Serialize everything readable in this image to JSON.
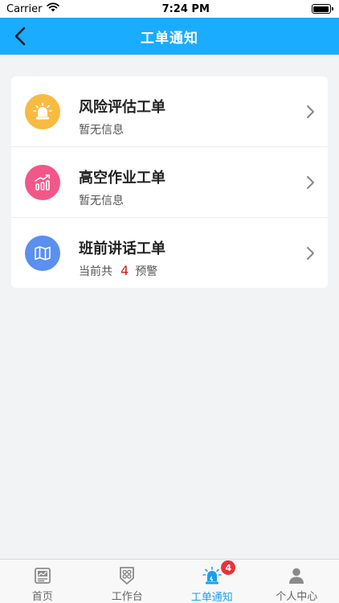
{
  "status_bar": {
    "carrier": "Carrier",
    "time": "7:24 PM"
  },
  "nav": {
    "title": "工单通知"
  },
  "work_orders": [
    {
      "title": "风险评估工单",
      "subtitle": "暂无信息",
      "icon": "alarm-light-icon",
      "color": "#f7bb42"
    },
    {
      "title": "高空作业工单",
      "subtitle": "暂无信息",
      "icon": "trend-chart-icon",
      "color": "#f2578a"
    },
    {
      "title": "班前讲话工单",
      "subtitle_prefix": "当前共",
      "count": "4",
      "subtitle_suffix": "预警",
      "icon": "map-icon",
      "color": "#5b8ff0"
    }
  ],
  "tabs": [
    {
      "label": "首页",
      "icon": "home-icon"
    },
    {
      "label": "工作台",
      "icon": "workbench-icon"
    },
    {
      "label": "工单通知",
      "icon": "alarm-icon",
      "badge": "4",
      "active": true
    },
    {
      "label": "个人中心",
      "icon": "user-icon"
    }
  ],
  "colors": {
    "accent": "#1aacff",
    "badge": "#e8333a",
    "active_tab": "#1a9ff2",
    "count": "#e01515"
  }
}
